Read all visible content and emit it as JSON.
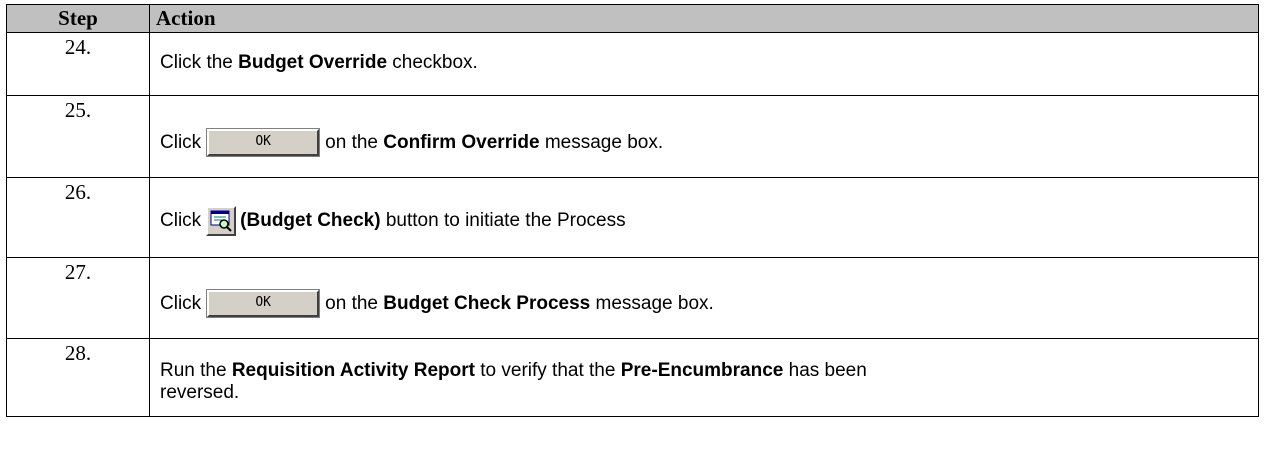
{
  "header": {
    "step": "Step",
    "action": "Action"
  },
  "rows": [
    {
      "num": "24.",
      "parts": [
        "Click the ",
        "Budget Override",
        " checkbox."
      ]
    },
    {
      "num": "25.",
      "click": "Click",
      "button_label": "OK",
      "after": [
        "on the ",
        "Confirm Override",
        " message box."
      ]
    },
    {
      "num": "26.",
      "click": "Click",
      "icon": "budget-check-icon",
      "bold": "(Budget Check)",
      "rest": " button to initiate the Process"
    },
    {
      "num": "27.",
      "click": "Click",
      "button_label": "OK",
      "after": [
        "on the ",
        "Budget Check Process",
        " message box."
      ]
    },
    {
      "num": "28.",
      "parts": [
        "Run the ",
        "Requisition Activity Report",
        " to verify that the ",
        "Pre-Encumbrance",
        " has been reversed."
      ]
    }
  ],
  "colors": {
    "header_bg": "#c0c0c0",
    "button_face": "#d4d0c8"
  }
}
